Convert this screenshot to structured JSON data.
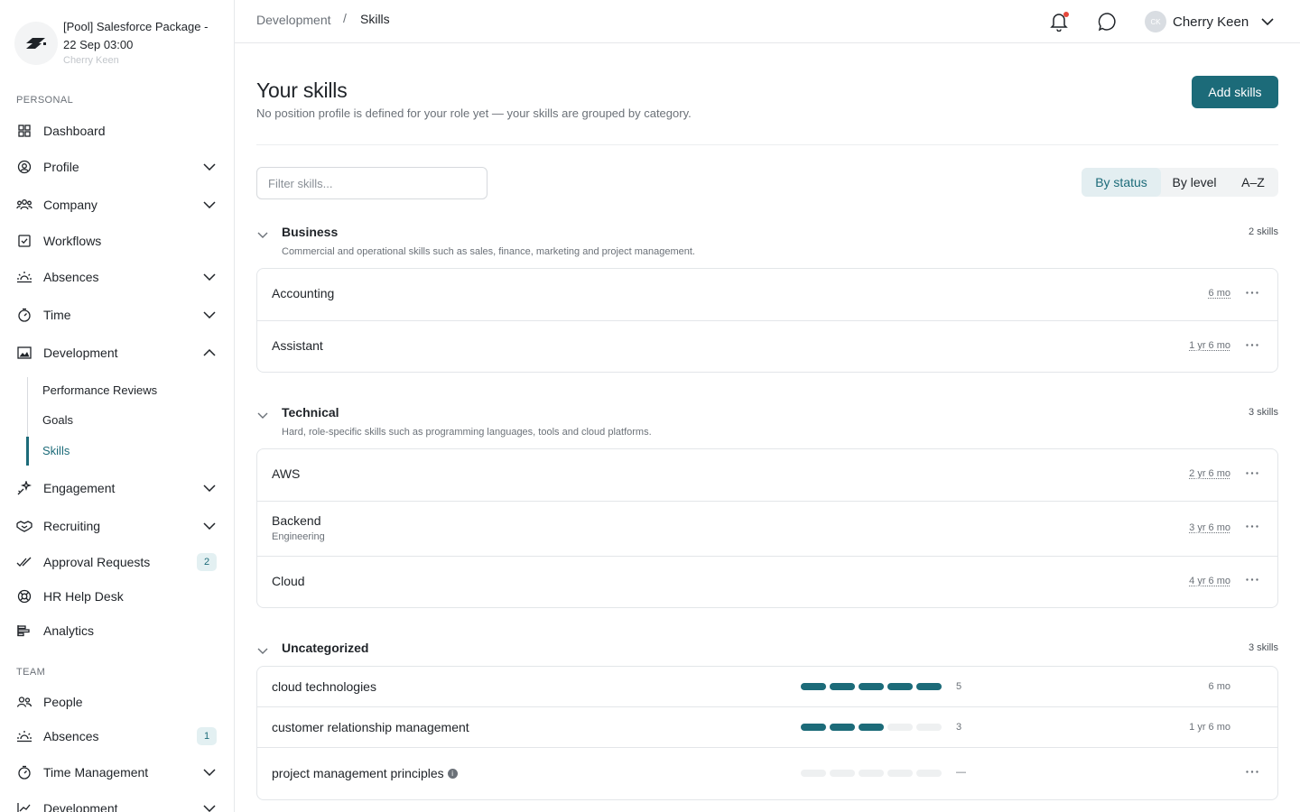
{
  "org": {
    "title": "[Pool] Salesforce Package - 22 Sep 03:00",
    "user": "Cherry Keen",
    "logo_icon": "org-logo-icon"
  },
  "sidebar": {
    "personal_label": "PERSONAL",
    "team_label": "TEAM",
    "personal_items": [
      {
        "label": "Dashboard",
        "icon": "grid-icon"
      },
      {
        "label": "Profile",
        "icon": "user-circle-icon",
        "expandable": true
      },
      {
        "label": "Company",
        "icon": "people-icon",
        "expandable": true
      },
      {
        "label": "Workflows",
        "icon": "checkbox-icon"
      },
      {
        "label": "Absences",
        "icon": "sunrise-icon",
        "expandable": true
      },
      {
        "label": "Time",
        "icon": "stopwatch-icon",
        "expandable": true
      },
      {
        "label": "Development",
        "icon": "chart-image-icon",
        "expanded": true
      },
      {
        "label": "Engagement",
        "icon": "sparkle-icon",
        "expandable": true
      },
      {
        "label": "Recruiting",
        "icon": "handshake-icon",
        "expandable": true
      },
      {
        "label": "Approval Requests",
        "icon": "double-check-icon",
        "badge": "2"
      },
      {
        "label": "HR Help Desk",
        "icon": "lifebuoy-icon"
      },
      {
        "label": "Analytics",
        "icon": "bar-list-icon"
      }
    ],
    "development_sub": [
      "Performance Reviews",
      "Goals",
      "Skills"
    ],
    "team_items": [
      {
        "label": "People",
        "icon": "people-icon"
      },
      {
        "label": "Absences",
        "icon": "sunrise-icon",
        "badge": "1"
      },
      {
        "label": "Time Management",
        "icon": "stopwatch-icon",
        "expandable": true
      },
      {
        "label": "Development",
        "icon": "trend-icon",
        "expandable": true
      }
    ]
  },
  "topbar": {
    "breadcrumb": [
      "Development",
      "Skills"
    ],
    "separator": "/",
    "user_name": "Cherry Keen",
    "avatar_initials": "CK"
  },
  "page": {
    "title": "Your skills",
    "subtitle": "No position profile is defined for your role yet — your skills are grouped by category.",
    "add_button": "Add skills",
    "filter_placeholder": "Filter skills...",
    "sort_options": [
      "By status",
      "By level",
      "A–Z"
    ],
    "active_sort": "By status"
  },
  "categories": [
    {
      "name": "Business",
      "description": "Commercial and operational skills such as sales, finance, marketing and project management.",
      "count": "2 skills",
      "skills": [
        {
          "name": "Accounting",
          "duration": "6 mo"
        },
        {
          "name": "Assistant",
          "duration": "1 yr 6 mo"
        }
      ]
    },
    {
      "name": "Technical",
      "description": "Hard, role-specific skills such as programming languages, tools and cloud platforms.",
      "count": "3 skills",
      "skills": [
        {
          "name": "AWS",
          "duration": "2 yr 6 mo"
        },
        {
          "name": "Backend",
          "sub": "Engineering",
          "duration": "3 yr 6 mo"
        },
        {
          "name": "Cloud",
          "duration": "4 yr 6 mo"
        }
      ]
    },
    {
      "name": "Uncategorized",
      "count": "3 skills",
      "skills": [
        {
          "name": "cloud technologies",
          "level": 5,
          "level_text": "5",
          "max_level": 5,
          "duration": "6 mo"
        },
        {
          "name": "customer relationship management",
          "level": 3,
          "level_text": "3",
          "max_level": 5,
          "duration": "1 yr 6 mo"
        },
        {
          "name": "project management principles",
          "level": 0,
          "level_text": "—",
          "max_level": 5,
          "info": true
        }
      ]
    }
  ],
  "colors": {
    "accent": "#1c6b79",
    "accent_soft": "#e3eef1",
    "text": "#1f2328",
    "muted": "#6b7178",
    "border": "#e3e6e9",
    "notification": "#e5483c"
  }
}
